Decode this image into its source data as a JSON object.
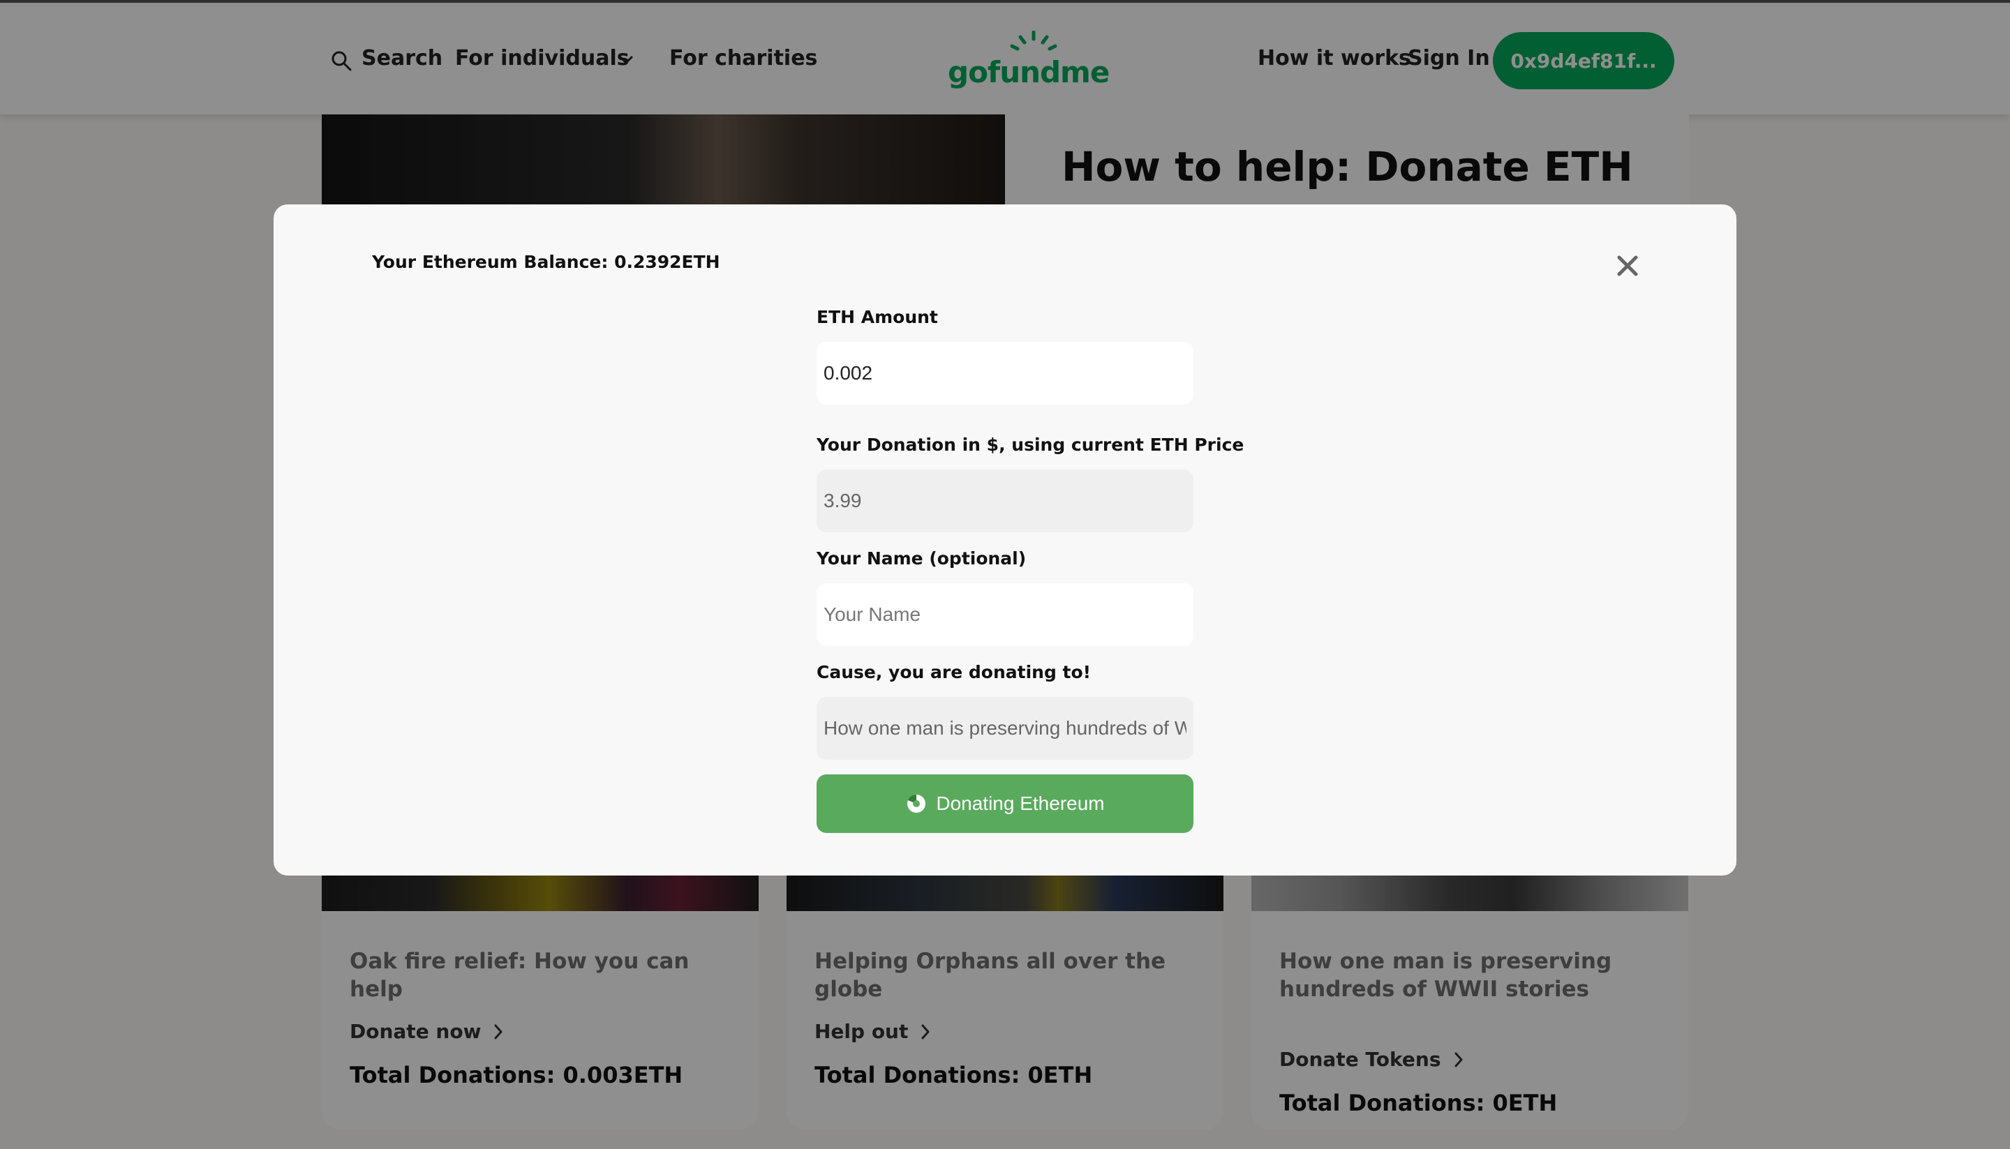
{
  "header": {
    "search_label": "Search",
    "individuals_label": "For individuals",
    "charities_label": "For charities",
    "logo_text": "gofundme",
    "how_it_works_label": "How it works",
    "sign_in_label": "Sign In",
    "wallet_label": "0x9d4ef81f..."
  },
  "hero": {
    "title": "How to help: Donate ETH"
  },
  "cards": [
    {
      "title": "Oak fire relief: How you can help",
      "link": "Donate now",
      "total": "Total Donations: 0.003ETH"
    },
    {
      "title": "Helping Orphans all over the globe",
      "link": "Help out",
      "total": "Total Donations: 0ETH"
    },
    {
      "title": "How one man is preserving hundreds of WWII stories",
      "link": "Donate Tokens",
      "total": "Total Donations: 0ETH"
    }
  ],
  "modal": {
    "balance": "Your Ethereum Balance: 0.2392ETH",
    "eth_amount_label": "ETH Amount",
    "eth_amount_value": "0.002",
    "usd_label": "Your Donation in $, using current ETH Price",
    "usd_value": "3.99",
    "name_label": "Your Name (optional)",
    "name_placeholder": "Your Name",
    "cause_label": "Cause, you are donating to!",
    "cause_value": "How one man is preserving hundreds of WW",
    "donate_button": "Donating Ethereum"
  },
  "colors": {
    "brand_green": "#02a95c",
    "button_green": "#5aaa5d"
  }
}
